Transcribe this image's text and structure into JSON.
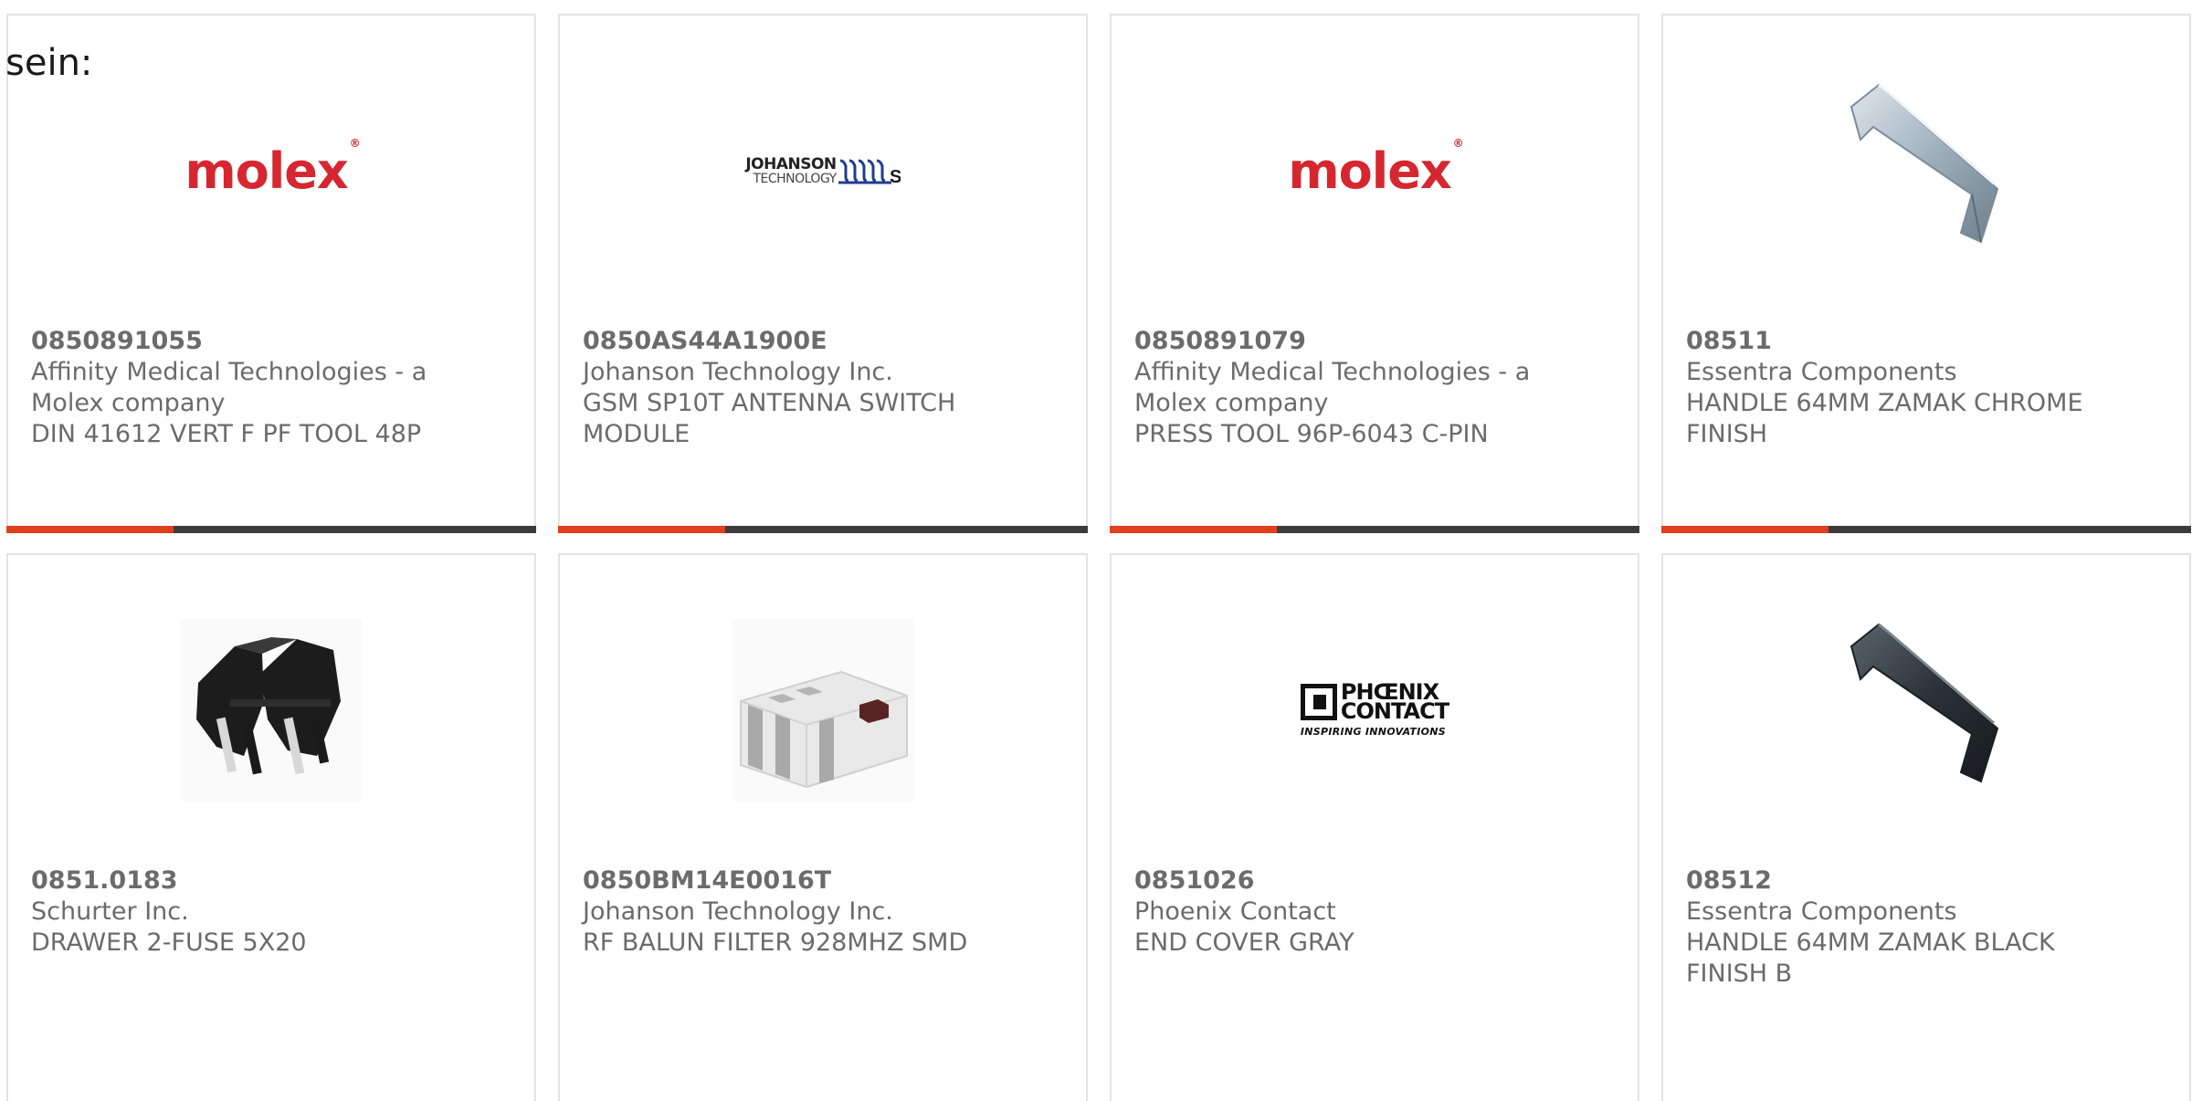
{
  "stray_text": "sein:",
  "colors": {
    "accent": "#e1401c",
    "bar": "#3c3c3c",
    "text": "#6b6b6b",
    "border": "#e3e3e3",
    "molex_red": "#d6262f"
  },
  "products": [
    {
      "part": "0850891055",
      "manufacturer": "Affinity Medical Technologies - a Molex company",
      "description": "DIN 41612 VERT F PF TOOL 48P",
      "image": "molex-logo",
      "logo_text": "molex",
      "logo_mark": "®"
    },
    {
      "part": "0850AS44A1900E",
      "manufacturer": "Johanson Technology Inc.",
      "description": "GSM SP10T ANTENNA SWITCH MODULE",
      "image": "johanson-logo",
      "logo_line1": "JOHANSON",
      "logo_line2": "TECHNOLOGY"
    },
    {
      "part": "0850891079",
      "manufacturer": "Affinity Medical Technologies - a Molex company",
      "description": "PRESS TOOL 96P-6043 C-PIN",
      "image": "molex-logo",
      "logo_text": "molex",
      "logo_mark": "®"
    },
    {
      "part": "08511",
      "manufacturer": "Essentra Components",
      "description": "HANDLE 64MM ZAMAK CHROME FINISH",
      "image": "chrome-handle-photo"
    },
    {
      "part": "0851.0183",
      "manufacturer": "Schurter Inc.",
      "description": "DRAWER 2-FUSE 5X20",
      "image": "fuse-drawer-photo"
    },
    {
      "part": "0850BM14E0016T",
      "manufacturer": "Johanson Technology Inc.",
      "description": "RF BALUN FILTER 928MHZ SMD",
      "image": "balun-chip-photo"
    },
    {
      "part": "0851026",
      "manufacturer": "Phoenix Contact",
      "description": "END COVER GRAY",
      "image": "phoenix-logo",
      "logo_line1": "PHŒNIX",
      "logo_line2": "CONTACT",
      "logo_tagline": "INSPIRING INNOVATIONS"
    },
    {
      "part": "08512",
      "manufacturer": "Essentra Components",
      "description": "HANDLE 64MM ZAMAK BLACK FINISH B",
      "image": "black-handle-photo"
    }
  ]
}
